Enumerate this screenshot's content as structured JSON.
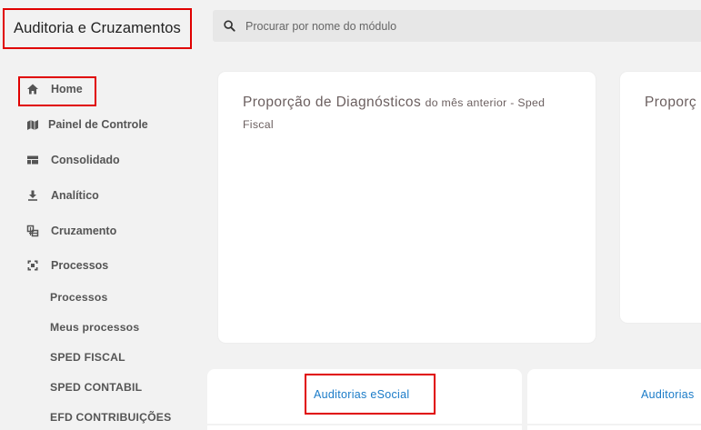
{
  "app": {
    "title": "Auditoria e Cruzamentos"
  },
  "search": {
    "placeholder": "Procurar por nome do módulo",
    "icon": "search-icon"
  },
  "sidebar": {
    "items": [
      {
        "label": "Home",
        "icon": "home-icon"
      },
      {
        "label": "Painel de Controle",
        "icon": "dashboard-icon"
      },
      {
        "label": "Consolidado",
        "icon": "consolidated-icon"
      },
      {
        "label": "Analítico",
        "icon": "download-icon"
      },
      {
        "label": "Cruzamento",
        "icon": "cross-icon"
      },
      {
        "label": "Processos",
        "icon": "processes-icon"
      }
    ],
    "subitems": [
      "Processos",
      "Meus processos",
      "SPED FISCAL",
      "SPED CONTABIL",
      "EFD CONTRIBUIÇÕES"
    ]
  },
  "cards": [
    {
      "title": "Proporção de Diagnósticos",
      "subtitle": "do mês anterior - Sped Fiscal"
    },
    {
      "title": "Proporç"
    }
  ],
  "tabs": [
    {
      "label": "Auditorias eSocial"
    },
    {
      "label": "Auditorias"
    }
  ],
  "colors": {
    "highlight": "#e00000",
    "link": "#1a7bc8",
    "background": "#f2f2f2"
  }
}
